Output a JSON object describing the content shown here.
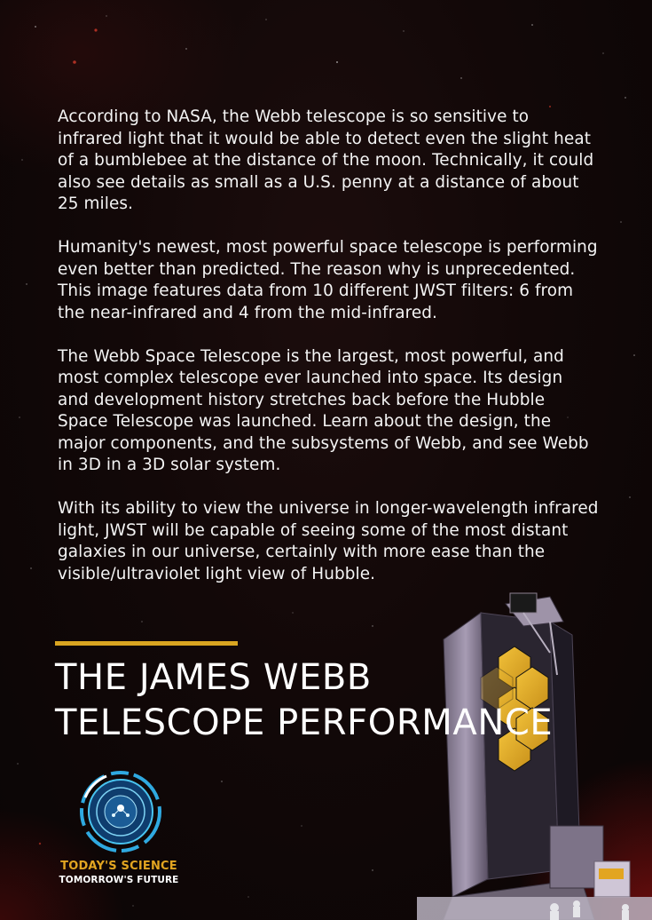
{
  "article": {
    "paragraphs": [
      "According to NASA, the Webb telescope is so sensitive to infrared light that it would be able to detect even the slight heat of a bumblebee at the distance of the moon. Technically, it could also see details as small as a U.S. penny at a distance of about 25 miles.",
      "Humanity's newest, most powerful space telescope is performing even better than predicted. The reason why is unprecedented. This image features data from 10 different JWST filters: 6 from the near-infrared and 4 from the mid-infrared.",
      "The Webb Space Telescope is the largest, most powerful, and most complex telescope ever launched into space. Its design and development history stretches back before the Hubble Space Telescope was launched. Learn about the design, the major components, and the subsystems of Webb, and see Webb in 3D in a 3D solar system.",
      "With its ability to view the universe in longer-wavelength infrared light, JWST will be capable of seeing some of the most distant galaxies in our universe, certainly with more ease than the visible/ultraviolet light view of Hubble."
    ]
  },
  "headline": {
    "line1": "THE JAMES WEBB",
    "line2": "TELESCOPE PERFORMANCE"
  },
  "logo": {
    "line1": "TODAY'S SCIENCE",
    "line2": "TOMORROW'S FUTURE",
    "icon": "globe-emblem-icon"
  },
  "colors": {
    "accent": "#d9a521",
    "background": "#120808",
    "mirror": "#e8b428"
  }
}
